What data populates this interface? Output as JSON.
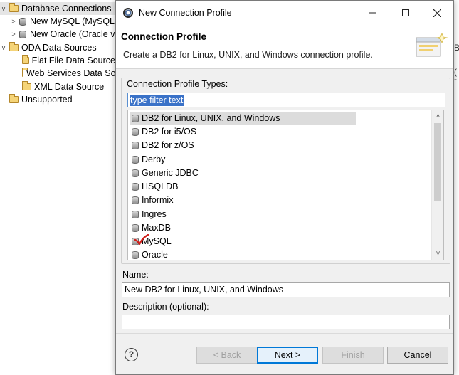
{
  "tree": {
    "items": [
      {
        "label": "Database Connections",
        "twisty": "v",
        "icon": "folder-open-icon"
      },
      {
        "label": "New MySQL (MySQL",
        "twisty": ">",
        "icon": "database-icon"
      },
      {
        "label": "New Oracle (Oracle v",
        "twisty": ">",
        "icon": "database-icon"
      },
      {
        "label": "ODA Data Sources",
        "twisty": "v",
        "icon": "folder-open-icon"
      },
      {
        "label": "Flat File Data Source",
        "twisty": "",
        "icon": "folder-icon"
      },
      {
        "label": "Web Services Data So",
        "twisty": "",
        "icon": "folder-icon"
      },
      {
        "label": "XML Data Source",
        "twisty": "",
        "icon": "folder-icon"
      },
      {
        "label": "Unsupported",
        "twisty": "",
        "icon": "folder-icon"
      }
    ],
    "right_clip_1": "B",
    "right_clip_2": "(",
    "right_clip_3": "-"
  },
  "dialog": {
    "title": "New Connection Profile",
    "header_title": "Connection Profile",
    "header_description": "Create a DB2 for Linux, UNIX, and Windows connection profile.",
    "group_label": "Connection Profile Types:",
    "filter_text": "type filter text",
    "profile_types": [
      "DB2 for Linux, UNIX, and Windows",
      "DB2 for i5/OS",
      "DB2 for z/OS",
      "Derby",
      "Generic JDBC",
      "HSQLDB",
      "Informix",
      "Ingres",
      "MaxDB",
      "MySQL",
      "Oracle"
    ],
    "selected_type_index": 0,
    "name_label": "Name:",
    "name_value": "New DB2 for Linux, UNIX, and Windows",
    "description_label": "Description (optional):",
    "description_value": "",
    "buttons": {
      "help": "?",
      "back": "< Back",
      "next": "Next >",
      "finish": "Finish",
      "cancel": "Cancel"
    }
  },
  "colors": {
    "selection_blue": "#3a72c8",
    "focus_border": "#5a8fd0",
    "default_button_border": "#0078d7",
    "check_mark": "#d0201b"
  }
}
